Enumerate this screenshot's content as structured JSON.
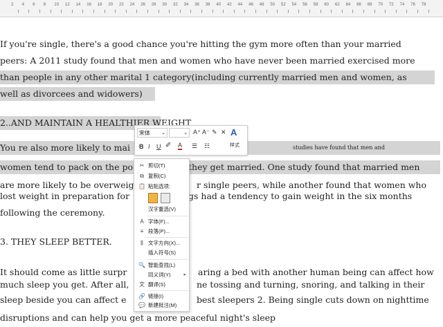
{
  "ruler": {
    "labels": [
      "2",
      "4",
      "6",
      "8",
      "10",
      "12",
      "14",
      "16",
      "18",
      "20",
      "22",
      "24",
      "26",
      "28",
      "30",
      "32",
      "34",
      "36",
      "38",
      "40",
      "42",
      "44",
      "46",
      "48",
      "50",
      "52",
      "54",
      "56",
      "58",
      "60",
      "62",
      "64",
      "66",
      "68",
      "70",
      "72",
      "74",
      "76",
      "78"
    ]
  },
  "document": {
    "p1": [
      " If you're single, there's a good chance you're hitting the gym more often than your married",
      "peers: A 2011 study found that men and women who have never been married exercised more",
      "than people in any other marital 1 category(including currently married men and women, as",
      " well as divorcees and widowers)"
    ],
    "h2": "2..AND MAINTAIN A HEALTHIER WEIGHT",
    "p2_l1_a": "You re also more likely to mai",
    "p2_l1_b": "studies have found that men and",
    "p2_l2_a": "women tend to pack on the po",
    "p2_l2_b": "they get married. One study found that married men",
    "p2_l3_a": "are more likely to be overweig",
    "p2_l3_b": "r single peers, while another found that women who",
    "p2_l4_a": "lost weight in preparation for",
    "p2_l4_b": "gs had a tendency to gain weight in the six months",
    "p2_l5": " following the ceremony.",
    "h3": "3. THEY SLEEP BETTER.",
    "p3_l1_a": "It should come as little surpr",
    "p3_l1_b": "aring a bed with another human being can affect how",
    "p3_l2_a": "much sleep you get. After all,",
    "p3_l2_b": "ne tossing and turning, snoring, and talking in their",
    "p3_l3_a": "sleep beside you can affect e",
    "p3_l3_b": "best sleepers 2. Being single cuts down on nighttime",
    "p3_l4": "disruptions and can help you get a more peaceful night's sleep"
  },
  "toolbar": {
    "font_name": "宋体",
    "font_size": "",
    "grow_font": "A⁺",
    "shrink_font": "A⁻",
    "styles_label": "样式",
    "bold": "B",
    "italic": "I",
    "underline": "U",
    "font_color": "A"
  },
  "context_menu": {
    "items": [
      {
        "icon": "✂",
        "label": "剪切(T)"
      },
      {
        "icon": "⧉",
        "label": "复制(C)"
      },
      {
        "icon": "📋",
        "label": "粘贴选项:"
      },
      {
        "icon": "",
        "label": "汉字重选(V)"
      },
      {
        "icon": "A",
        "label": "字体(F)..."
      },
      {
        "icon": "≡",
        "label": "段落(P)..."
      },
      {
        "icon": "⫼",
        "label": "文字方向(X)..."
      },
      {
        "icon": "",
        "label": "插入符号(S)"
      },
      {
        "icon": "🔍",
        "label": "智能查找(L)"
      },
      {
        "icon": "",
        "label": "同义词(Y)"
      },
      {
        "icon": "文",
        "label": "翻译(S)"
      },
      {
        "icon": "🔗",
        "label": "链接(I)"
      },
      {
        "icon": "💬",
        "label": "新建批注(M)"
      }
    ]
  },
  "colors": {
    "highlight": "#d4d4d4",
    "font_color_bar": "#e02020"
  }
}
